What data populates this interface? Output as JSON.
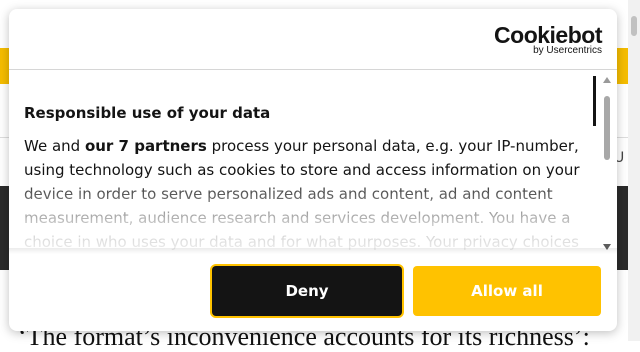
{
  "background": {
    "edge_text": "U",
    "headline": "‘The format’s inconvenience accounts for its richness’:"
  },
  "consent": {
    "logo": {
      "word": "Cookiebot",
      "sub": "by Usercentrics"
    },
    "heading": "Responsible use of your data",
    "body": {
      "intro": "We and ",
      "partners": "our 7 partners",
      "rest": " process your personal data, e.g. your IP-number, using technology such as cookies to store and access information on your device in order to serve personalized ads and content, ad and content measurement, audience research and services development. You have a choice in who uses your data and for what purposes. Your privacy choices"
    },
    "buttons": {
      "deny": "Deny",
      "allow_all": "Allow all"
    },
    "colors": {
      "accent": "#ffc200",
      "dark": "#141414"
    }
  }
}
